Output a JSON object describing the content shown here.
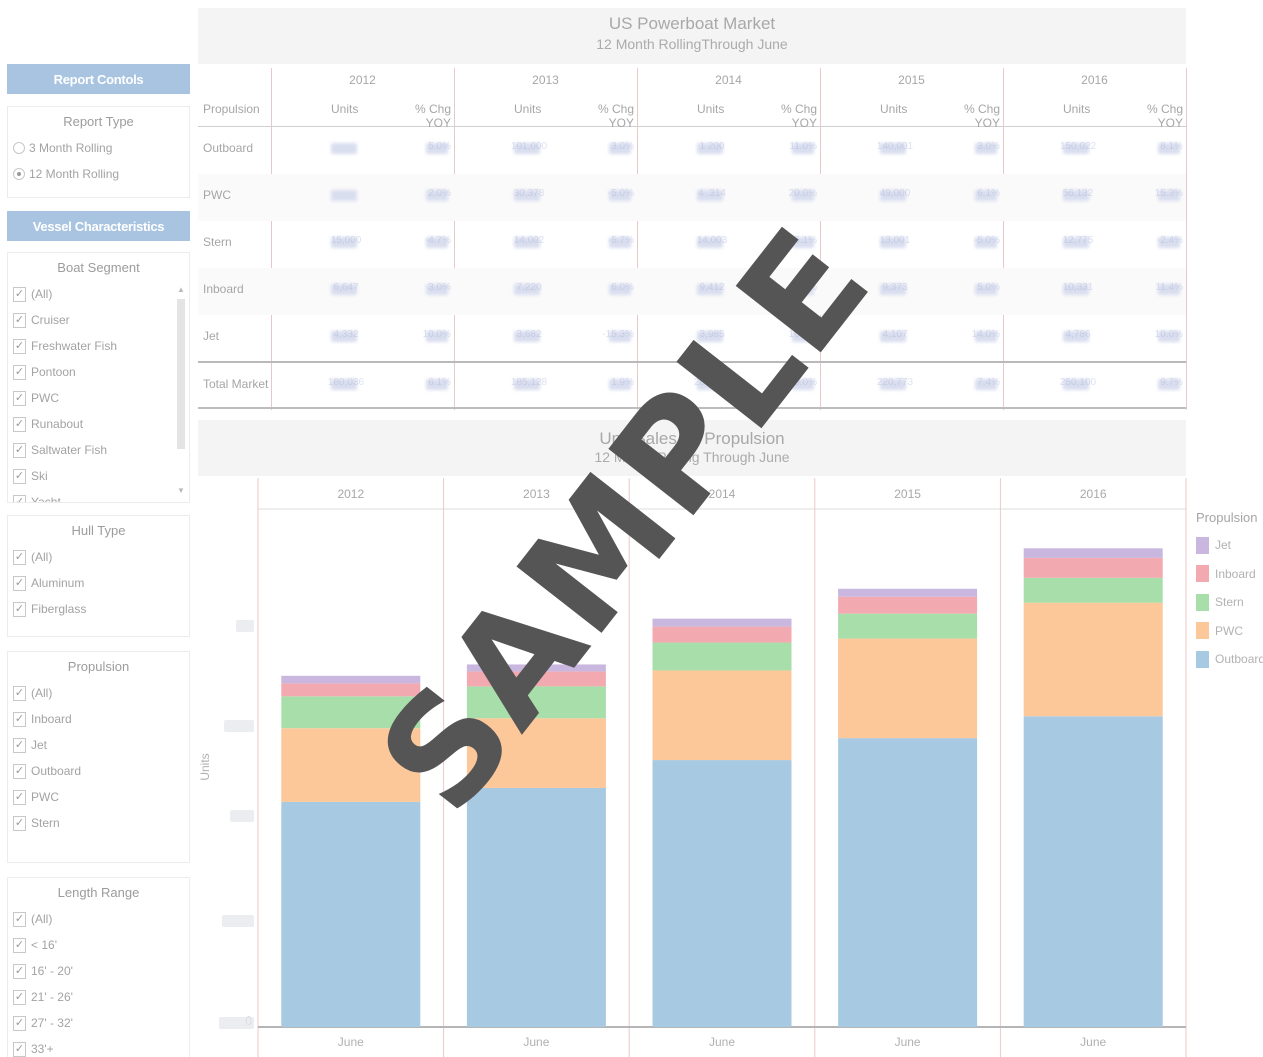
{
  "sidebar": {
    "report_controls_label": "Report Contols",
    "report_type": {
      "title": "Report Type",
      "options": [
        {
          "label": "3 Month Rolling",
          "selected": false
        },
        {
          "label": "12 Month Rolling",
          "selected": true
        }
      ]
    },
    "vessel_characteristics_label": "Vessel Characteristics",
    "boat_segment": {
      "title": "Boat Segment",
      "items": [
        "(All)",
        "Cruiser",
        "Freshwater Fish",
        "Pontoon",
        "PWC",
        "Runabout",
        "Saltwater Fish",
        "Ski",
        "Yacht"
      ]
    },
    "hull_type": {
      "title": "Hull Type",
      "items": [
        "(All)",
        "Aluminum",
        "Fiberglass"
      ]
    },
    "propulsion": {
      "title": "Propulsion",
      "items": [
        "(All)",
        "Inboard",
        "Jet",
        "Outboard",
        "PWC",
        "Stern"
      ]
    },
    "length_range": {
      "title": "Length Range",
      "items": [
        "(All)",
        "< 16'",
        "16' - 20'",
        "21' - 26'",
        "27' - 32'",
        "33'+"
      ]
    }
  },
  "table": {
    "title": "US Powerboat Market",
    "subtitle": "12 Month RollingThrough June",
    "row_header": "Propulsion",
    "years": [
      "2012",
      "2013",
      "2014",
      "2015",
      "2016"
    ],
    "col_units": "Units",
    "col_chg": "% Chg YOY",
    "rows": [
      {
        "name": "Outboard",
        "cells": [
          [
            "",
            "5.0%"
          ],
          [
            "101,000",
            "3.0%"
          ],
          [
            "1 200",
            "11.0%"
          ],
          [
            "140,001",
            "3.0%"
          ],
          [
            "150,022",
            "8.1%"
          ]
        ]
      },
      {
        "name": "PWC",
        "cells": [
          [
            "",
            "2.0%"
          ],
          [
            "30,378",
            "-5.0%"
          ],
          [
            "4 .314",
            "20.0%"
          ],
          [
            "49,000",
            "6.1%"
          ],
          [
            "56,132",
            "15.3%"
          ]
        ]
      },
      {
        "name": "Stern",
        "cells": [
          [
            "15,000",
            "-4.7%"
          ],
          [
            "14,002",
            "-5.7%"
          ],
          [
            "14,003",
            "-5.1%"
          ],
          [
            "13,001",
            "-5.0%"
          ],
          [
            "12,775",
            "-2.4%"
          ]
        ]
      },
      {
        "name": "Inboard",
        "cells": [
          [
            "6,647",
            "3.0%"
          ],
          [
            "7,220",
            "6.0%"
          ],
          [
            "9,412",
            "11.0%"
          ],
          [
            "9,373",
            "5.0%"
          ],
          [
            "10,331",
            "11.4%"
          ]
        ]
      },
      {
        "name": "Jet",
        "cells": [
          [
            "4,332",
            "10.0%"
          ],
          [
            "3,682",
            "-15.3%"
          ],
          [
            "3,985",
            "10.0%"
          ],
          [
            "4,107",
            "14.0%"
          ],
          [
            "4,786",
            "10.0%"
          ]
        ]
      }
    ],
    "total": {
      "name": "Total Market",
      "cells": [
        [
          "180,036",
          "6.1%"
        ],
        [
          "185,128",
          "1.9%"
        ],
        [
          "200,000",
          "10.0%"
        ],
        [
          "220,773",
          "7.4%"
        ],
        [
          "250,100",
          "9.7%"
        ]
      ]
    }
  },
  "chart": {
    "title": "Unit Sales by Propulsion",
    "subtitle": "12 Month Rolling Through June",
    "y_label": "Units",
    "y_tick_zero": "0",
    "x_label": "June"
  },
  "legend": {
    "title": "Propulsion",
    "items": [
      {
        "name": "Jet",
        "color": "#c9b7e0"
      },
      {
        "name": "Inboard",
        "color": "#f2aab0"
      },
      {
        "name": "Stern",
        "color": "#a8deaa"
      },
      {
        "name": "PWC",
        "color": "#fcc89a"
      },
      {
        "name": "Outboard",
        "color": "#a8c9e2"
      }
    ]
  },
  "watermark": "SAMPLE",
  "chart_data": {
    "type": "bar",
    "stacked": true,
    "categories": [
      "2012",
      "2013",
      "2014",
      "2015",
      "2016"
    ],
    "series": [
      {
        "name": "Outboard",
        "values": [
          113000,
          120000,
          134000,
          145000,
          156000
        ]
      },
      {
        "name": "PWC",
        "values": [
          37000,
          35000,
          45000,
          50000,
          57000
        ]
      },
      {
        "name": "Stern",
        "values": [
          16000,
          16000,
          14000,
          12500,
          12500
        ]
      },
      {
        "name": "Inboard",
        "values": [
          6500,
          7500,
          8000,
          8500,
          10000
        ]
      },
      {
        "name": "Jet",
        "values": [
          3800,
          3500,
          4000,
          4000,
          4800
        ]
      }
    ],
    "ylim": [
      0,
      250000
    ],
    "ylabel": "Units",
    "xlabel": "June"
  }
}
